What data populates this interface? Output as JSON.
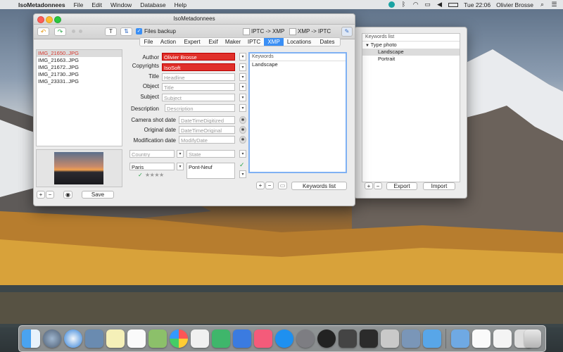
{
  "menubar": {
    "app_name": "IsoMetadonnees",
    "menus": [
      "File",
      "Edit",
      "Window",
      "Database",
      "Help"
    ],
    "time": "Tue 22:06",
    "user": "Olivier Brosse"
  },
  "main_window": {
    "title": "IsoMetadonnees",
    "files_backup_label": "Files backup",
    "iptc_to_xmp_label": "IPTC -> XMP",
    "xmp_to_iptc_label": "XMP -> IPTC",
    "files": [
      {
        "name": "IMG_21650..JPG",
        "selected": true
      },
      {
        "name": "IMG_21663..JPG",
        "selected": false
      },
      {
        "name": "IMG_21672..JPG",
        "selected": false
      },
      {
        "name": "IMG_21730..JPG",
        "selected": false
      },
      {
        "name": "IMG_23331..JPG",
        "selected": false
      }
    ],
    "save_label": "Save",
    "tabs": [
      "File",
      "Action",
      "Expert",
      "Exif",
      "Maker",
      "IPTC",
      "XMP",
      "Locations",
      "Dates"
    ],
    "active_tab": "XMP",
    "fields": [
      {
        "label": "Author",
        "value": "Olivier Brosse"
      },
      {
        "label": "Copyrights",
        "value": "IsoSoft"
      },
      {
        "label": "Title",
        "placeholder": "Headline"
      },
      {
        "label": "Object",
        "placeholder": "Title"
      },
      {
        "label": "Subject",
        "placeholder": "Subject"
      },
      {
        "label": "Description",
        "placeholder": "Description"
      },
      {
        "label": "Camera shot date",
        "placeholder": "DateTimeDigitized"
      },
      {
        "label": "Original date",
        "placeholder": "DateTimeOriginal"
      },
      {
        "label": "Modification date",
        "placeholder": "ModifyDate"
      }
    ],
    "country_placeholder": "Country",
    "state_placeholder": "State",
    "city_value": "Paris",
    "location_value": "Pont-Neuf",
    "rating_stars": "★★★★",
    "keywords_header": "Keywords",
    "keywords": [
      "Landscape"
    ],
    "keywords_list_button": "Keywords list"
  },
  "keywords_window": {
    "title": "Keywords list",
    "tree_root": "Type photo",
    "tree_items": [
      {
        "label": "Landscape",
        "selected": true
      },
      {
        "label": "Portrait",
        "selected": false
      }
    ],
    "export_label": "Export",
    "import_label": "Import"
  },
  "colors": {
    "accent": "#3a8ff5",
    "required_field": "#e0302a"
  }
}
